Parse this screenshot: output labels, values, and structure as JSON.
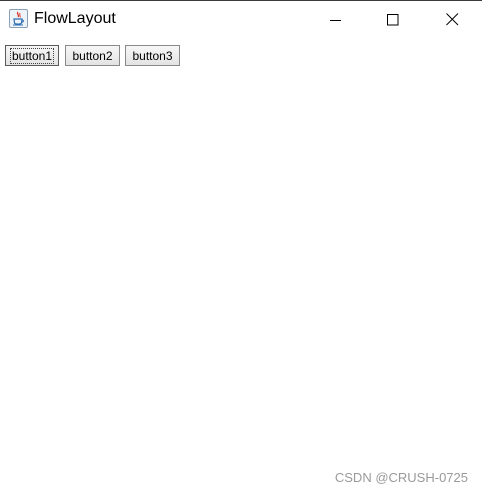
{
  "window": {
    "title": "FlowLayout",
    "icon": "java-icon"
  },
  "title_buttons": {
    "minimize_icon": "minimize-icon",
    "maximize_icon": "maximize-icon",
    "close_icon": "close-icon"
  },
  "buttons": [
    {
      "label": "button1",
      "focused": true
    },
    {
      "label": "button2",
      "focused": false
    },
    {
      "label": "button3",
      "focused": false
    }
  ],
  "watermark": "CSDN @CRUSH-0725",
  "colors": {
    "java_red": "#d83b2c",
    "java_blue": "#2c6fb5",
    "watermark": "#9a9a9a"
  }
}
